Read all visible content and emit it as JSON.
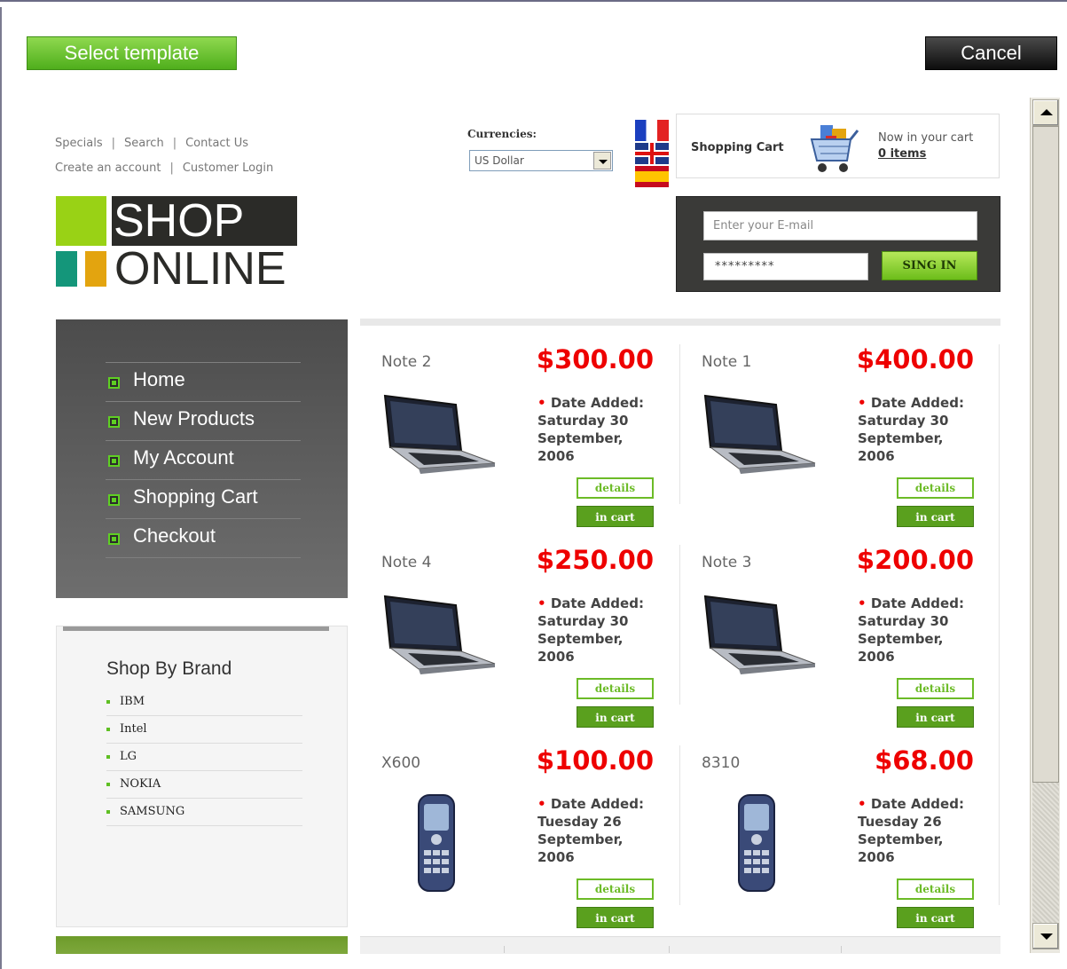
{
  "dialog": {
    "select_template_label": "Select template",
    "cancel_label": "Cancel"
  },
  "top_links": {
    "row1": [
      "Specials",
      "Search",
      "Contact Us"
    ],
    "row2": [
      "Create an account",
      "Customer Login"
    ]
  },
  "logo": {
    "line1": "SHOP",
    "line2": "ONLINE"
  },
  "currencies": {
    "label": "Currencies:",
    "selected": "US Dollar"
  },
  "flags": [
    "france-flag-icon",
    "uk-flag-icon",
    "spain-flag-icon"
  ],
  "cart": {
    "title": "Shopping Cart",
    "now_in_cart": "Now in your cart",
    "items": "0 items"
  },
  "login": {
    "email_placeholder": "Enter your E-mail",
    "password_value": "*********",
    "signin_label": "SING IN"
  },
  "nav": {
    "items": [
      "Home",
      "New Products",
      "My Account",
      "Shopping Cart",
      "Checkout"
    ]
  },
  "brands": {
    "title": "Shop By Brand",
    "items": [
      "IBM",
      "Intel",
      "LG",
      "NOKIA",
      "SAMSUNG"
    ]
  },
  "products": [
    {
      "name": "Note 2",
      "price": "$300.00",
      "date_label": "Date Added:",
      "date": "Saturday 30 September, 2006",
      "details": "details",
      "in_cart": "in cart",
      "kind": "laptop"
    },
    {
      "name": "Note 1",
      "price": "$400.00",
      "date_label": "Date Added:",
      "date": "Saturday 30 September, 2006",
      "details": "details",
      "in_cart": "in cart",
      "kind": "laptop"
    },
    {
      "name": "Note 4",
      "price": "$250.00",
      "date_label": "Date Added:",
      "date": "Saturday 30 September, 2006",
      "details": "details",
      "in_cart": "in cart",
      "kind": "laptop"
    },
    {
      "name": "Note 3",
      "price": "$200.00",
      "date_label": "Date Added:",
      "date": "Saturday 30 September, 2006",
      "details": "details",
      "in_cart": "in cart",
      "kind": "laptop"
    },
    {
      "name": "X600",
      "price": "$100.00",
      "date_label": "Date Added:",
      "date": "Tuesday 26 September, 2006",
      "details": "details",
      "in_cart": "in cart",
      "kind": "phone"
    },
    {
      "name": "8310",
      "price": "$68.00",
      "date_label": "Date Added:",
      "date": "Tuesday 26 September, 2006",
      "details": "details",
      "in_cart": "in cart",
      "kind": "phone"
    }
  ],
  "colors": {
    "accent_green": "#5aa01e",
    "price_red": "#e00000",
    "nav_dark": "#4c4c4c"
  }
}
